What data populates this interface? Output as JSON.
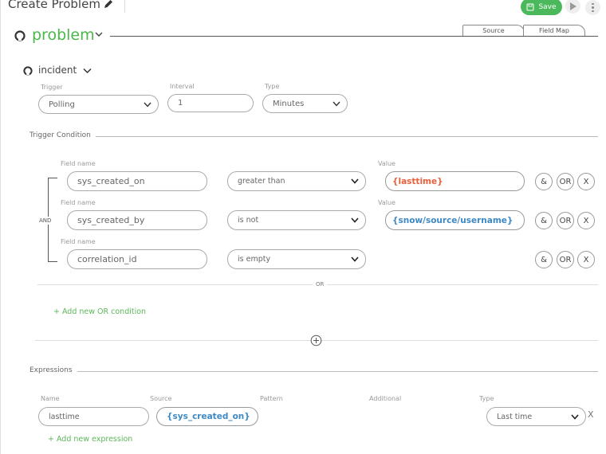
{
  "header": {
    "title": "Create Problem",
    "save_label": "Save"
  },
  "problem": {
    "name": "problem",
    "tabs": [
      {
        "label": "Source"
      },
      {
        "label": "Field Map"
      }
    ]
  },
  "incident": {
    "name": "incident",
    "trigger_label": "Trigger",
    "trigger_value": "Polling",
    "interval_label": "Interval",
    "interval_value": "1",
    "type_label": "Type",
    "type_value": "Minutes"
  },
  "trigger_condition": {
    "title": "Trigger Condition",
    "and_label": "AND",
    "or_label": "OR",
    "conditions": [
      {
        "field_label": "Field name",
        "field": "sys_created_on",
        "operator": "greater than",
        "value_label": "Value",
        "value": "{lasttime}"
      },
      {
        "field_label": "Field name",
        "field": "sys_created_by",
        "operator": "is not",
        "value_label": "Value",
        "value": "{snow/source/username}"
      },
      {
        "field_label": "Field name",
        "field": "correlation_id",
        "operator": "is empty"
      }
    ],
    "btn_and": "&",
    "btn_or": "OR",
    "btn_x": "X",
    "add_or_label": "+ Add new OR condition"
  },
  "expressions": {
    "title": "Expressions",
    "name_label": "Name",
    "source_label": "Source",
    "pattern_label": "Pattern",
    "additional_label": "Additional",
    "type_label": "Type",
    "name_value": "lasttime",
    "source_value": "{sys_created_on}",
    "type_value": "Last time",
    "remove_label": "X",
    "add_label": "+ Add new expression"
  },
  "colors": {
    "accent_green": "#49b849",
    "save_green": "#4cb85c",
    "value_red": "#e8603c",
    "value_blue": "#3d89c4"
  }
}
